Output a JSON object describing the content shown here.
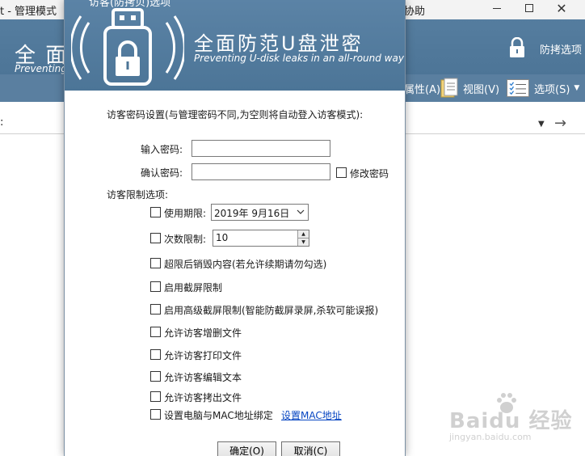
{
  "background_window": {
    "title_left": "t - 管理模式",
    "title_right": "协助",
    "banner_title": "全 面",
    "banner_sub": "Preventing",
    "guard_option_label": "防拷选项",
    "toolbar": {
      "properties_label": "属性(A)",
      "view_label": "视图(V)",
      "options_label": "选项(S)"
    },
    "address_colon": ":"
  },
  "dialog": {
    "title_fragment": "访客(防拷贝)选项",
    "brand_title": "全面防范U盘泄密",
    "brand_subtitle": "Preventing U-disk leaks in an all-round way",
    "guest_password_heading": "访客密码设置(与管理密码不同,为空则将自动登入访客模式):",
    "password_label": "输入密码:",
    "password_value": "",
    "confirm_label": "确认密码:",
    "confirm_value": "",
    "change_password_label": "修改密码",
    "change_password_checked": false,
    "restrictions_heading": "访客限制选项:",
    "usage_period_label": "使用期限:",
    "usage_period_checked": false,
    "usage_date_value": "2019年 9月16日",
    "count_limit_label": "次数限制:",
    "count_limit_checked": false,
    "count_value": "10",
    "options": [
      {
        "label": "超限后销毁内容(若允许续期请勿勾选)",
        "checked": false
      },
      {
        "label": "启用截屏限制",
        "checked": false
      },
      {
        "label": "启用高级截屏限制(智能防截屏录屏,杀软可能误报)",
        "checked": false
      },
      {
        "label": "允许访客增删文件",
        "checked": false
      },
      {
        "label": "允许访客打印文件",
        "checked": false
      },
      {
        "label": "允许访客编辑文本",
        "checked": false
      },
      {
        "label": "允许访客拷出文件",
        "checked": false
      },
      {
        "label": "设置电脑与MAC地址绑定",
        "checked": false
      }
    ],
    "mac_link_label": "设置MAC地址",
    "ok_label": "确定(O)",
    "cancel_label": "取消(C)"
  },
  "watermark": {
    "text": "Baidu 经验",
    "url": "jingyan.baidu.com"
  },
  "colors": {
    "header_blue": "#4c7597",
    "toolbar_blue": "#5a7fa0",
    "link_blue": "#0645c2"
  }
}
